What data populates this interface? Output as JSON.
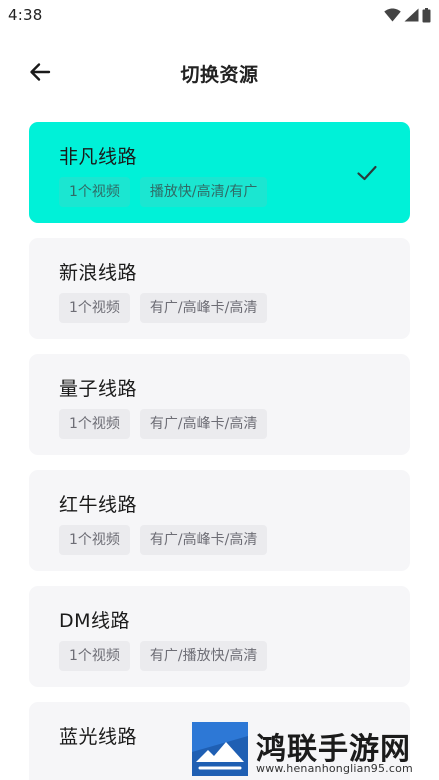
{
  "status_bar": {
    "time": "4:38"
  },
  "header": {
    "title": "切换资源"
  },
  "sources": [
    {
      "name": "非凡线路",
      "count": "1个视频",
      "tag": "播放快/高清/有广",
      "selected": true
    },
    {
      "name": "新浪线路",
      "count": "1个视频",
      "tag": "有广/高峰卡/高清",
      "selected": false
    },
    {
      "name": "量子线路",
      "count": "1个视频",
      "tag": "有广/高峰卡/高清",
      "selected": false
    },
    {
      "name": "红牛线路",
      "count": "1个视频",
      "tag": "有广/高峰卡/高清",
      "selected": false
    },
    {
      "name": "DM线路",
      "count": "1个视频",
      "tag": "有广/播放快/高清",
      "selected": false
    },
    {
      "name": "蓝光线路",
      "count": "",
      "tag": "",
      "selected": false
    }
  ],
  "watermark": {
    "brand": "鸿联手游网",
    "url": "www.henanhonglian95.com"
  },
  "colors": {
    "accent": "#00f1d8",
    "card_bg": "#f6f6f8",
    "tag_bg": "#ebebee"
  },
  "icons": {
    "back": "arrow-left-icon",
    "selected": "checkmark-icon",
    "wifi": "wifi-icon",
    "signal": "signal-icon",
    "battery": "battery-icon"
  }
}
